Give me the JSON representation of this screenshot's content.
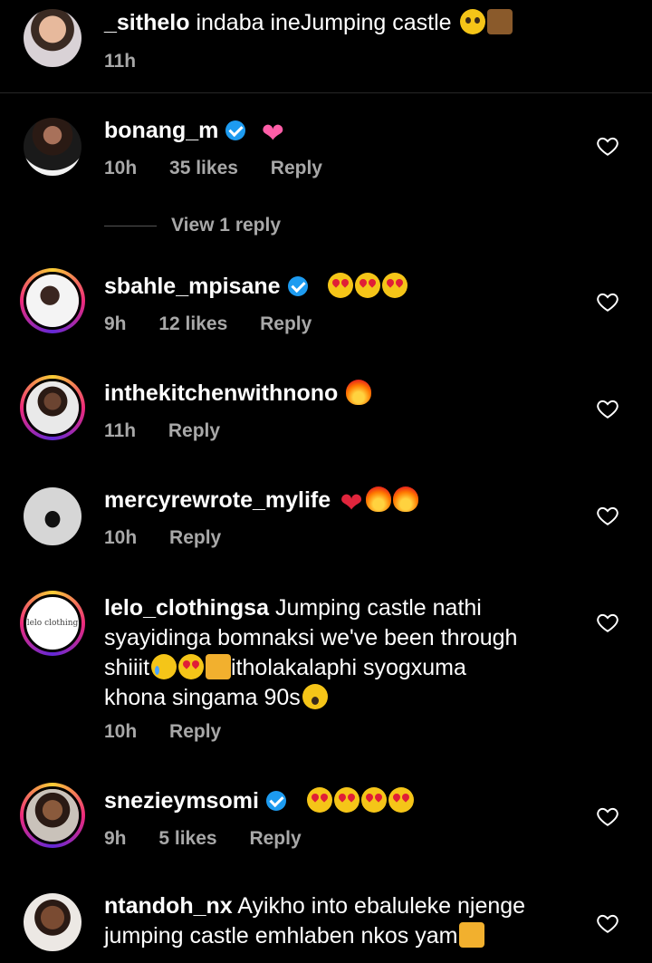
{
  "comments": [
    {
      "username": "_sithelo",
      "text": "indaba ineJumping castle",
      "emojis": [
        "pleading-face",
        "crossed-fingers"
      ],
      "time": "11h"
    },
    {
      "username": "bonang_m",
      "verified": true,
      "text": "",
      "emojis": [
        "sparkling-heart"
      ],
      "time": "10h",
      "likes": "35 likes",
      "reply": "Reply"
    },
    {
      "username": "sbahle_mpisane",
      "verified": true,
      "text": "",
      "emojis": [
        "heart-eyes",
        "heart-eyes",
        "heart-eyes"
      ],
      "time": "9h",
      "likes": "12 likes",
      "reply": "Reply"
    },
    {
      "username": "inthekitchenwithnono",
      "text": "",
      "emojis": [
        "fire"
      ],
      "time": "11h",
      "reply": "Reply"
    },
    {
      "username": "mercyrewrote_mylife",
      "text": "",
      "emojis": [
        "red-heart",
        "fire",
        "fire"
      ],
      "time": "10h",
      "reply": "Reply"
    },
    {
      "username": "lelo_clothingsa",
      "text_line1": "Jumping castle nathi",
      "text_line2": "syayidinga bomnaksi we've been through",
      "text_line3a": "shiiit",
      "text_line3b": "itholakalaphi syogxuma",
      "text_line4": "khona singama 90s",
      "time": "10h",
      "reply": "Reply"
    },
    {
      "username": "snezieymsomi",
      "verified": true,
      "text": "",
      "emojis": [
        "heart-eyes",
        "heart-eyes",
        "heart-eyes",
        "heart-eyes"
      ],
      "time": "9h",
      "likes": "5 likes",
      "reply": "Reply"
    },
    {
      "username": "ntandoh_nx",
      "text_line1": "Ayikho into ebaluleke njenge",
      "text_line2": "jumping castle emhlaben nkos yam"
    }
  ],
  "view_replies": "View 1 reply",
  "avatar_texts": {
    "lelo": "lelo clothing"
  }
}
